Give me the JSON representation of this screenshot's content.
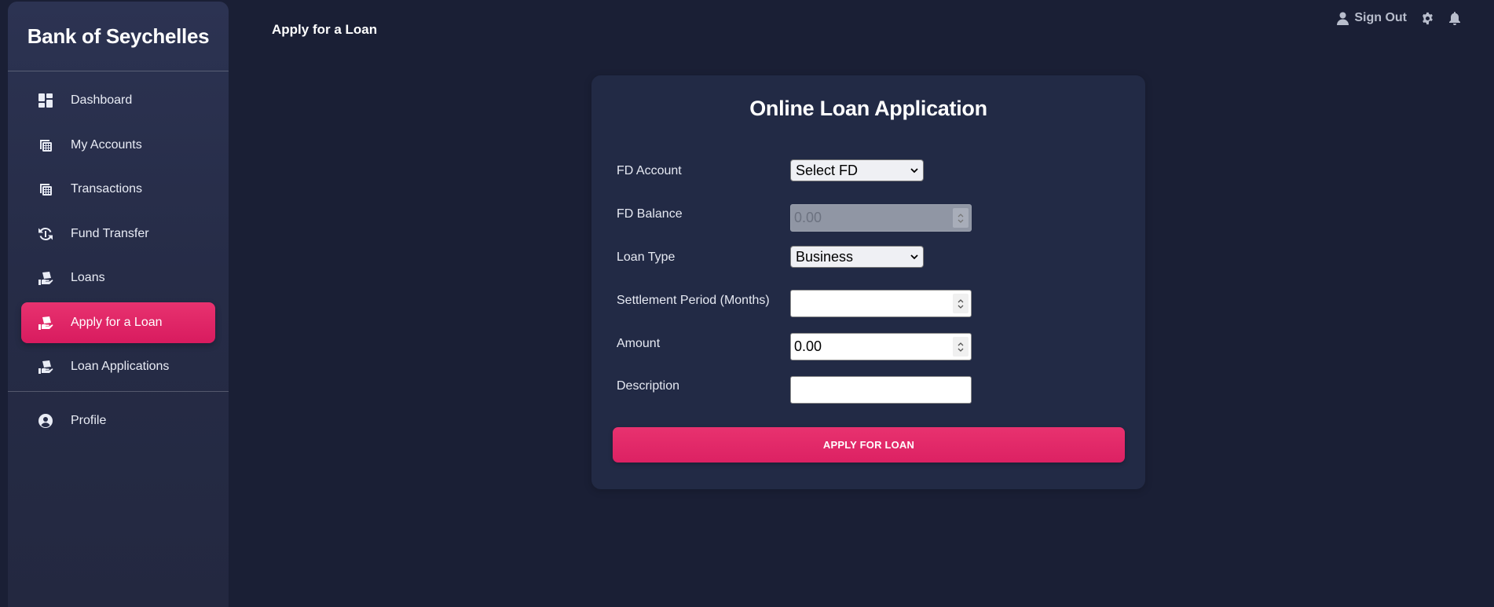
{
  "brand": "Bank of Seychelles",
  "nav": [
    {
      "label": "Dashboard",
      "icon": "dashboard-icon"
    },
    {
      "label": "My Accounts",
      "icon": "accounts-icon"
    },
    {
      "label": "Transactions",
      "icon": "transactions-icon"
    },
    {
      "label": "Fund Transfer",
      "icon": "transfer-icon"
    },
    {
      "label": "Loans",
      "icon": "loan-icon"
    },
    {
      "label": "Apply for a Loan",
      "icon": "loan-icon",
      "active": true
    },
    {
      "label": "Loan Applications",
      "icon": "loan-icon"
    }
  ],
  "nav_secondary": [
    {
      "label": "Profile",
      "icon": "profile-icon"
    }
  ],
  "header": {
    "title": "Apply for a Loan",
    "sign_out": "Sign Out"
  },
  "form": {
    "title": "Online Loan Application",
    "fd_account": {
      "label": "FD Account",
      "value": "Select FD"
    },
    "fd_balance": {
      "label": "FD Balance",
      "value": "0.00"
    },
    "loan_type": {
      "label": "Loan Type",
      "value": "Business"
    },
    "settlement_period": {
      "label": "Settlement Period (Months)",
      "value": ""
    },
    "amount": {
      "label": "Amount",
      "value": "0.00"
    },
    "description": {
      "label": "Description",
      "value": ""
    },
    "submit_label": "APPLY FOR LOAN"
  },
  "colors": {
    "background": "#1a1f35",
    "sidebar": "#2a3150",
    "card": "#222a45",
    "accent": "#e0286a"
  }
}
